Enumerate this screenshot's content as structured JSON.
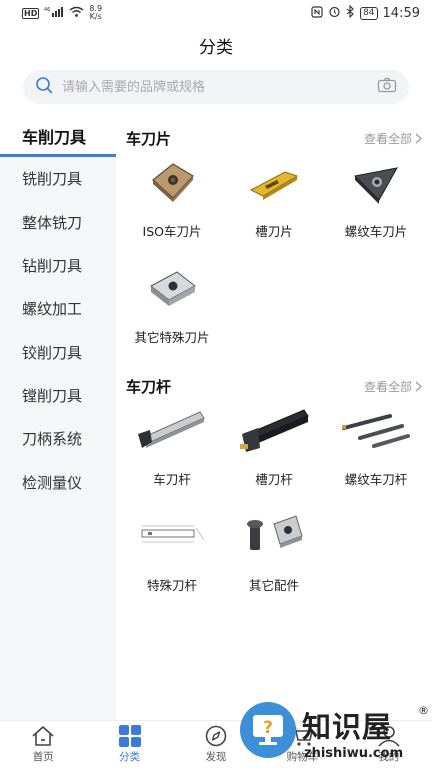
{
  "status_bar": {
    "hd": "HD",
    "signal": "⁴⁶",
    "speed_value": "8.9",
    "speed_unit": "K/s",
    "battery": "84",
    "time": "14:59"
  },
  "header": {
    "title": "分类"
  },
  "search": {
    "placeholder": "请输入需要的品牌或规格"
  },
  "sidebar": {
    "items": [
      {
        "label": "车削刀具",
        "active": true
      },
      {
        "label": "铣削刀具"
      },
      {
        "label": "整体铣刀"
      },
      {
        "label": "钻削刀具"
      },
      {
        "label": "螺纹加工"
      },
      {
        "label": "铰削刀具"
      },
      {
        "label": "镗削刀具"
      },
      {
        "label": "刀柄系统"
      },
      {
        "label": "检测量仪"
      }
    ]
  },
  "content": {
    "sections": [
      {
        "title": "车刀片",
        "view_all": "查看全部",
        "items": [
          {
            "label": "ISO车刀片"
          },
          {
            "label": "槽刀片"
          },
          {
            "label": "螺纹车刀片"
          },
          {
            "label": "其它特殊刀片"
          }
        ]
      },
      {
        "title": "车刀杆",
        "view_all": "查看全部",
        "items": [
          {
            "label": "车刀杆"
          },
          {
            "label": "槽刀杆"
          },
          {
            "label": "螺纹车刀杆"
          },
          {
            "label": "特殊刀杆"
          },
          {
            "label": "其它配件"
          }
        ]
      }
    ]
  },
  "tabbar": {
    "tabs": [
      {
        "label": "首页",
        "icon": "home-icon"
      },
      {
        "label": "分类",
        "icon": "category-grid-icon",
        "active": true
      },
      {
        "label": "发现",
        "icon": "compass-icon"
      },
      {
        "label": "购物车",
        "icon": "cart-icon"
      },
      {
        "label": "我的",
        "icon": "user-icon"
      }
    ]
  },
  "watermark": {
    "title": "知识屋",
    "registered": "®",
    "url": "zhishiwu.com"
  },
  "colors": {
    "accent": "#3d7bd8",
    "sidebar_bg": "#f5f6f8",
    "search_bg": "#f2f3f5"
  }
}
